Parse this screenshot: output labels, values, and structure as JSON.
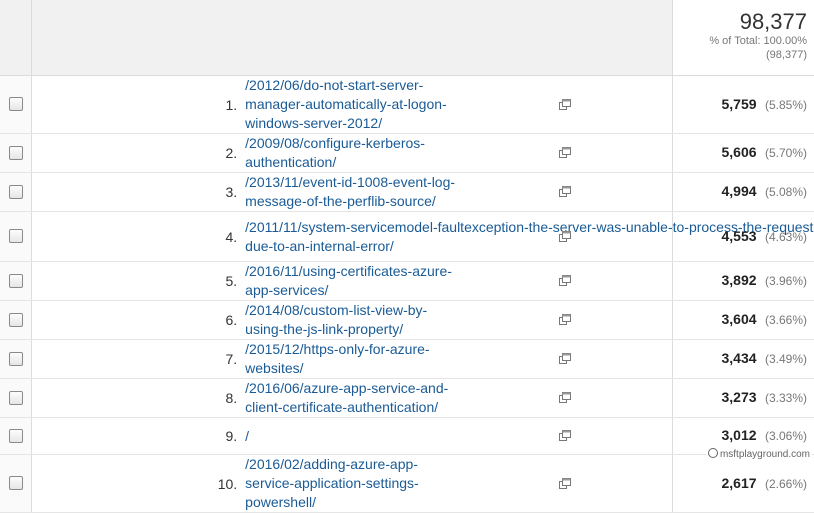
{
  "summary": {
    "total_value": "98,377",
    "percent_label": "% of Total: 100.00%",
    "percent_count": "(98,377)"
  },
  "rows": [
    {
      "index": "1.",
      "page": "/2012/06/do-not-start-server-manager-automatically-at-logon-windows-server-2012/",
      "value": "5,759",
      "percent": "(5.85%)"
    },
    {
      "index": "2.",
      "page": "/2009/08/configure-kerberos-authentication/",
      "value": "5,606",
      "percent": "(5.70%)"
    },
    {
      "index": "3.",
      "page": "/2013/11/event-id-1008-event-log-message-of-the-perflib-source/",
      "value": "4,994",
      "percent": "(5.08%)"
    },
    {
      "index": "4.",
      "page_line1": "/2011/11/system-servicemodel-faultexception-the-server-was-unable-to-process-the-request-",
      "page_line2": "due-to-an-internal-error/",
      "value": "4,553",
      "percent": "(4.63%)"
    },
    {
      "index": "5.",
      "page": "/2016/11/using-certificates-azure-app-services/",
      "value": "3,892",
      "percent": "(3.96%)"
    },
    {
      "index": "6.",
      "page": "/2014/08/custom-list-view-by-using-the-js-link-property/",
      "value": "3,604",
      "percent": "(3.66%)"
    },
    {
      "index": "7.",
      "page": "/2015/12/https-only-for-azure-websites/",
      "value": "3,434",
      "percent": "(3.49%)"
    },
    {
      "index": "8.",
      "page": "/2016/06/azure-app-service-and-client-certificate-authentication/",
      "value": "3,273",
      "percent": "(3.33%)"
    },
    {
      "index": "9.",
      "page": "/",
      "value": "3,012",
      "percent": "(3.06%)"
    },
    {
      "index": "10.",
      "page": "/2016/02/adding-azure-app-service-application-settings-powershell/",
      "value": "2,617",
      "percent": "(2.66%)"
    }
  ],
  "icons": {
    "row_action": "open-in-new-window-icon",
    "watermark_logo": "copyright-icon"
  },
  "watermark": "msftplayground.com",
  "colors": {
    "link": "#1a5b96",
    "border": "#dcdcdc",
    "muted": "#777777"
  }
}
